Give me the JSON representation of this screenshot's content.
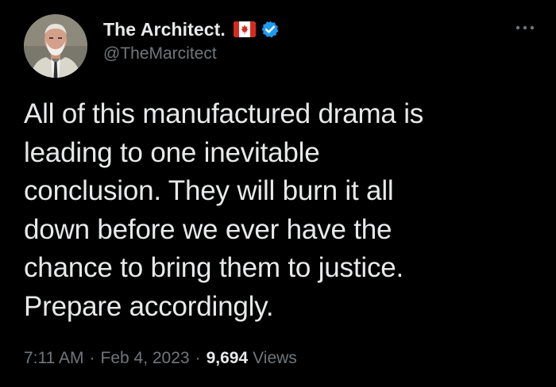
{
  "author": {
    "display_name": "The Architect.",
    "handle": "@TheMarcitect",
    "flag_icon": "canada-flag-icon",
    "verified_icon": "verified-badge-icon",
    "verified_color": "#1d9bf0"
  },
  "more_icon": "more-options-icon",
  "tweet": {
    "text": "All of this manufactured drama is\nleading to one inevitable\nconclusion. They will burn it all\ndown before we ever have the\nchance to bring them to justice.\nPrepare accordingly."
  },
  "meta": {
    "time": "7:11 AM",
    "separator": "·",
    "date": "Feb 4, 2023",
    "views_count": "9,694",
    "views_label": "Views"
  },
  "colors": {
    "background": "#000000",
    "text_primary": "#e7e9ea",
    "text_secondary": "#71767b",
    "flag_red": "#d52b1e"
  }
}
